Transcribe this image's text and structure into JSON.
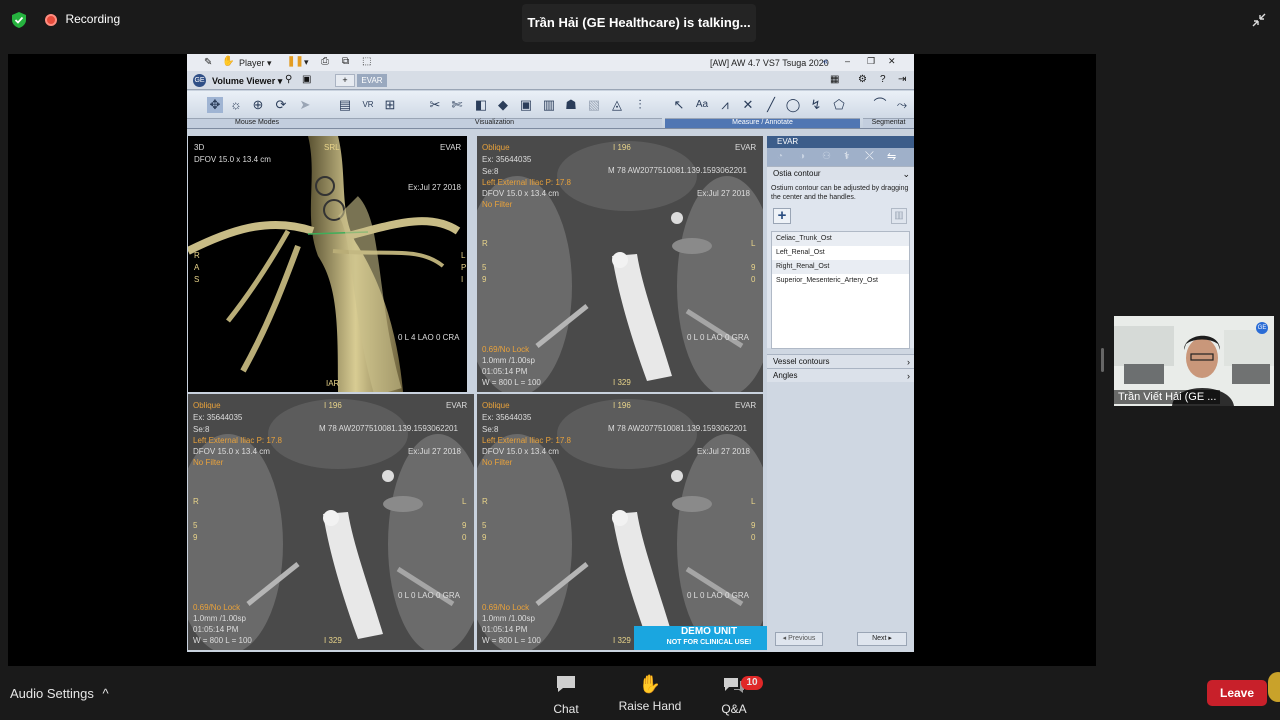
{
  "meeting": {
    "recording_label": "Recording",
    "talking_banner": "Trần Hải (GE Healthcare) is talking...",
    "participant_name": "Trần Viết Hải (GE ...",
    "audio_settings": "Audio Settings",
    "chat_label": "Chat",
    "raise_hand_label": "Raise Hand",
    "qa_label": "Q&A",
    "qa_badge": "10",
    "leave_label": "Leave"
  },
  "app": {
    "player_label": "Player",
    "window_title": "[AW] AW 4.7 VS7 Tsuga 2020",
    "menu_title": "Volume Viewer",
    "tab_label": "EVAR",
    "group_mouse_modes": "Mouse Modes",
    "group_visualization": "Visualization",
    "group_measure": "Measure / Annotate",
    "group_segment": "Segmentat",
    "demo_line1": "DEMO UNIT",
    "demo_line2": "NOT FOR CLINICAL USE!"
  },
  "viewport_3d": {
    "mode": "3D",
    "dfov": "DFOV 15.0 x 13.4 cm",
    "protocol": "EVAR",
    "top_orient": "SRL",
    "exam_date": "Ex:Jul 27 2018",
    "orient_left": [
      "R",
      "A",
      "S"
    ],
    "orient_right": [
      "L",
      "P",
      "I"
    ],
    "angle": "0 L 4 LAO 0 CRA",
    "bottom_orient": "IAR"
  },
  "viewport_oblique": {
    "mode": "Oblique",
    "exam_id": "Ex: 35644035",
    "series": "Se:8",
    "location": "Left External Iliac P: 17.8",
    "dfov": "DFOV 15.0 x 13.4 cm",
    "filter": "No Filter",
    "slice_top": "I 196",
    "protocol": "EVAR",
    "mrn": "M 78 AW2077510081.139.1593062201",
    "exam_date": "Ex:Jul 27 2018",
    "orient_left": [
      "R",
      "5",
      "9"
    ],
    "orient_right": [
      "L",
      "9",
      "0"
    ],
    "lock": "0.69/No Lock",
    "thickness": "1.0mm /1.00sp",
    "time": "01:05:14 PM",
    "window": "W = 800 L = 100",
    "slice_bottom": "I 329",
    "angle": "0 L 0 LAO 0 GRA"
  },
  "panel": {
    "header": "EVAR",
    "section_ostia": "Ostia contour",
    "ostia_help": "Ostium contour can be adjusted by dragging the center and the handles.",
    "ostia_items": [
      "Celiac_Trunk_Ost",
      "Left_Renal_Ost",
      "Right_Renal_Ost",
      "Superior_Mesenteric_Artery_Ost"
    ],
    "section_vessel": "Vessel contours",
    "section_angles": "Angles",
    "prev_label": "Previous",
    "next_label": "Next"
  }
}
